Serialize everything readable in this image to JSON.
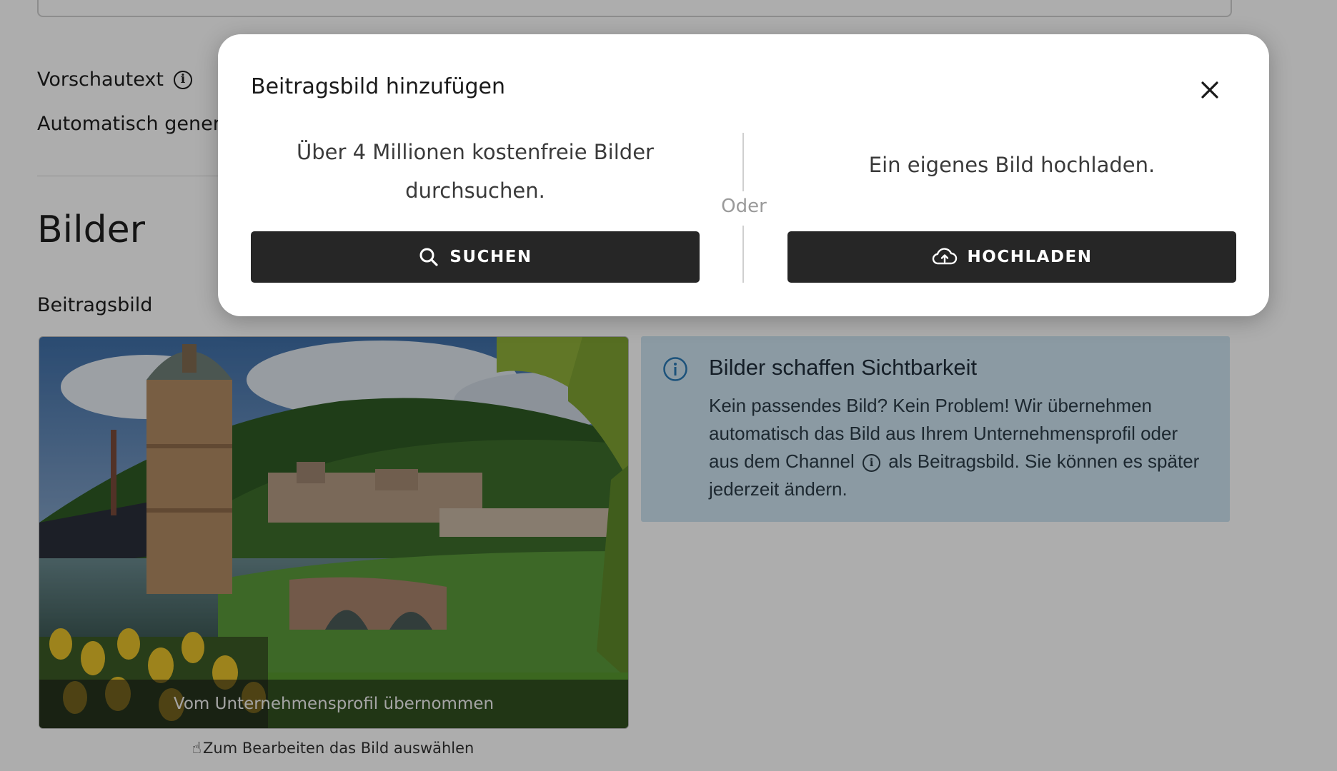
{
  "background": {
    "preview_label": "Vorschautext",
    "auto_generated_text": "Automatisch generi",
    "section_heading": "Bilder",
    "featured_image_label": "Beitragsbild",
    "image_caption": "Vom Unternehmensprofil übernommen",
    "image_hint": "Zum Bearbeiten das Bild auswählen",
    "info_box": {
      "title": "Bilder schaffen Sichtbarkeit",
      "text_before_icon": "Kein passendes Bild? Kein Problem! Wir übernehmen automatisch das Bild aus Ihrem Unternehmensprofil oder aus dem Channel",
      "text_after_icon": "als Beitragsbild. Sie können es später jederzeit ändern.",
      "accent_color": "#2a7ab5",
      "background_color": "#cde4f1"
    }
  },
  "modal": {
    "title": "Beitragsbild hinzufügen",
    "left_text": "Über 4 Millionen kostenfreie Bilder durchsuchen.",
    "right_text": "Ein eigenes Bild hochladen.",
    "or_label": "Oder",
    "search_button": "SUCHEN",
    "upload_button": "HOCHLADEN",
    "button_color": "#262626"
  },
  "icons": {
    "info": "info-icon",
    "close": "close-icon",
    "search": "search-icon",
    "upload": "cloud-upload-icon",
    "hand": "hand-pointer-icon"
  }
}
